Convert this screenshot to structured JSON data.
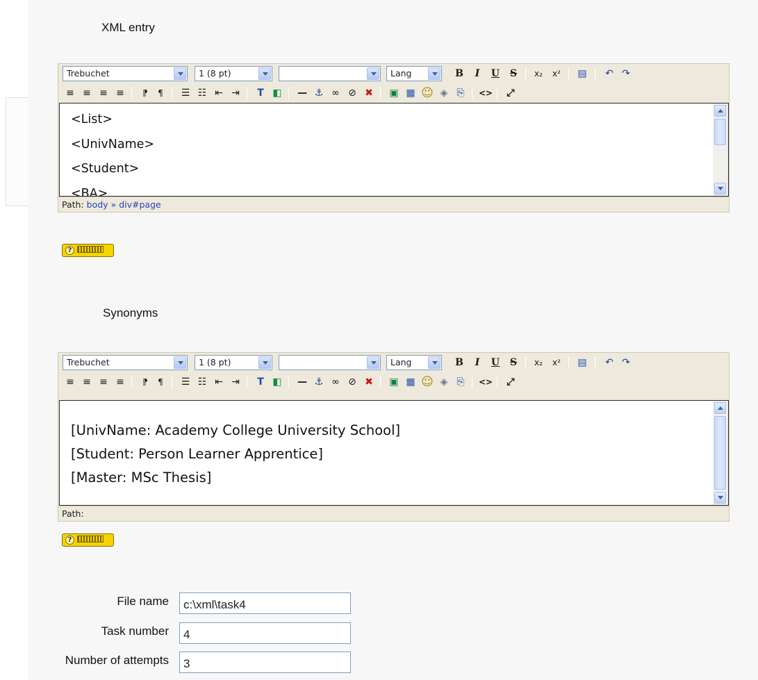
{
  "xml_entry": {
    "label": "XML entry",
    "toolbar": {
      "font": "Trebuchet",
      "size": "1 (8 pt)",
      "format": "",
      "lang": "Lang"
    },
    "content_lines": [
      "<List>",
      "<UnivName>",
      "<Student>",
      "<BA>"
    ],
    "path_label": "Path:",
    "path_body": "body",
    "path_sep": "»",
    "path_div": "div#page"
  },
  "synonyms": {
    "label": "Synonyms",
    "toolbar": {
      "font": "Trebuchet",
      "size": "1 (8 pt)",
      "format": "",
      "lang": "Lang"
    },
    "content_lines": [
      "[UnivName: Academy College University School]",
      "[Student: Person Learner Apprentice]",
      "[Master: MSc Thesis]"
    ],
    "path_label": "Path:"
  },
  "toolbar_icons": {
    "bold": "B",
    "italic": "I",
    "underline": "U",
    "strike": "S",
    "subscript": "x₂",
    "superscript": "x²",
    "undo": "↶",
    "redo": "↷",
    "align_left": "≡",
    "align_center": "≡",
    "align_right": "≡",
    "justify": "≡",
    "ltr": "⁋",
    "rtl": "¶",
    "ordered_list": "☰",
    "unordered_list": "☷",
    "outdent": "⇤",
    "indent": "⇥",
    "text_color": "T",
    "bg_color": "◧",
    "hr": "—",
    "anchor": "⚓",
    "link": "∞",
    "unlink": "⊘",
    "nolink": "✖",
    "image": "▣",
    "table": "▦",
    "smiley": "☺",
    "special_char": "◈",
    "search": "⎘",
    "html_source": "<>",
    "fullscreen": "⤢"
  },
  "form": {
    "file_name_label": "File name",
    "file_name_value": "c:\\xml\\task4",
    "task_number_label": "Task number",
    "task_number_value": "4",
    "attempts_label": "Number of attempts",
    "attempts_value": "3"
  }
}
